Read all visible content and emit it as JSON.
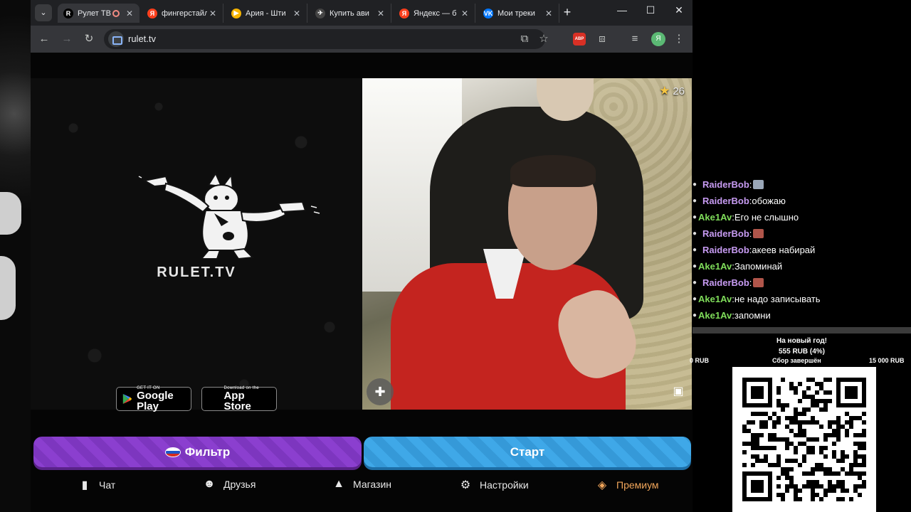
{
  "browser": {
    "tabs": [
      {
        "title": "Рулет ТВ",
        "favicon_color": "#000000",
        "favicon_text": "R",
        "active": true,
        "recording": true
      },
      {
        "title": "фингерстайл",
        "favicon_color": "#fc3f1d",
        "favicon_text": "Я"
      },
      {
        "title": "Ария - Шти",
        "favicon_color": "#f6b400",
        "favicon_text": "▶"
      },
      {
        "title": "Купить ави",
        "favicon_color": "#444444",
        "favicon_text": "✈"
      },
      {
        "title": "Яндекс — б",
        "favicon_color": "#fc3f1d",
        "favicon_text": "Я"
      },
      {
        "title": "Мои треки",
        "favicon_color": "#0077ff",
        "favicon_text": "VK"
      }
    ],
    "url": "rulet.tv",
    "extension_label": "ABP",
    "profile_initial": "Я"
  },
  "page": {
    "brand": "RULET.TV",
    "stores": {
      "google": {
        "small": "GET IT ON",
        "big": "Google Play"
      },
      "apple": {
        "small": "Download on the",
        "big": "App Store"
      }
    },
    "video": {
      "star_count": "26"
    },
    "buttons": {
      "filter": "Фильтр",
      "start": "Старт"
    },
    "nav": {
      "chat": "Чат",
      "friends": "Друзья",
      "shop": "Магазин",
      "settings": "Настройки",
      "premium": "Премиум"
    }
  },
  "stream": {
    "chat": [
      {
        "nick": "RaiderBob",
        "color": "#c79bf2",
        "text": "",
        "emote": "#9aa7b8"
      },
      {
        "nick": "RaiderBob",
        "color": "#c79bf2",
        "text": "обожаю"
      },
      {
        "nick": "Ake1Av",
        "color": "#7fdc5a",
        "text": "Его не слышно"
      },
      {
        "nick": "RaiderBob",
        "color": "#c79bf2",
        "text": "",
        "emote": "#b0554a"
      },
      {
        "nick": "RaiderBob",
        "color": "#c79bf2",
        "text": "акеев набирай"
      },
      {
        "nick": "Ake1Av",
        "color": "#7fdc5a",
        "text": "Запоминай"
      },
      {
        "nick": "RaiderBob",
        "color": "#c79bf2",
        "text": "",
        "emote": "#b0554a"
      },
      {
        "nick": "Ake1Av",
        "color": "#7fdc5a",
        "text": "не надо записывать"
      },
      {
        "nick": "Ake1Av",
        "color": "#7fdc5a",
        "text": "запомни"
      }
    ],
    "goal": {
      "title": "На новый год!",
      "amount": "555 RUB (4%)",
      "progress_percent": 4,
      "min": "0 RUB",
      "status": "Сбор завершён",
      "max": "15 000 RUB"
    }
  }
}
